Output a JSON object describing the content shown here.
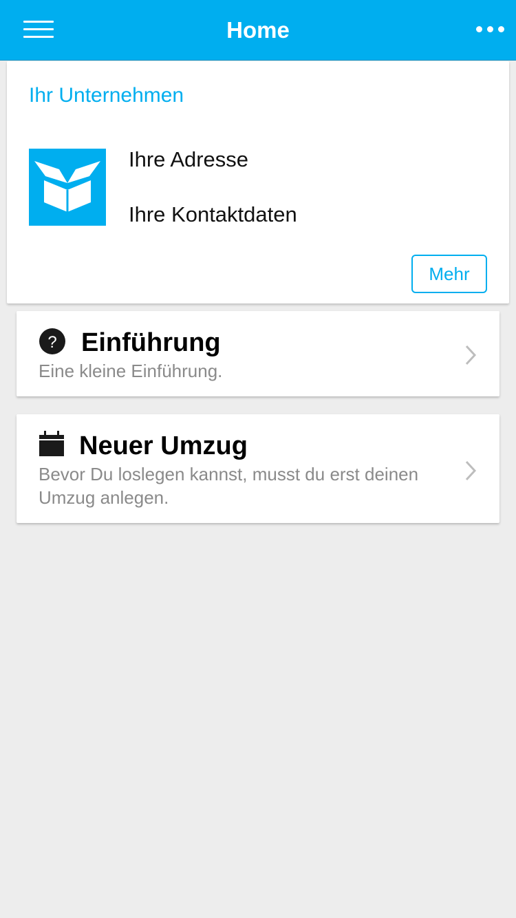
{
  "appbar": {
    "title": "Home",
    "menu_icon": "hamburger-menu-icon",
    "more_icon": "more-dots-icon",
    "color": "#00aeef"
  },
  "company": {
    "title": "Ihr Unternehmen",
    "logo_icon": "open-box-icon",
    "address": "Ihre Adresse",
    "contact": "Ihre Kontaktdaten",
    "more_button": "Mehr"
  },
  "cards": [
    {
      "icon": "help-circle-icon",
      "title": "Einführung",
      "subtitle": "Eine kleine Einführung.",
      "chevron": "chevron-right-icon"
    },
    {
      "icon": "calendar-icon",
      "title": "Neuer Umzug",
      "subtitle": "Bevor Du loslegen kannst, musst du erst deinen Umzug anlegen.",
      "chevron": "chevron-right-icon"
    }
  ]
}
